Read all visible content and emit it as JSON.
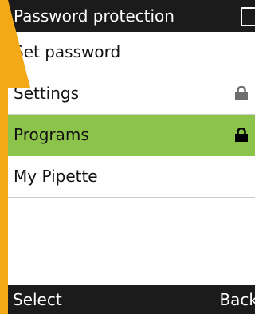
{
  "header": {
    "title": "Password protection",
    "battery_icon": "battery-icon"
  },
  "menu": {
    "items": [
      {
        "label": "Set password",
        "icon": "",
        "selected": false
      },
      {
        "label": "Settings",
        "icon": "lock-icon",
        "icon_color": "#6e6e6e",
        "selected": false
      },
      {
        "label": "Programs",
        "icon": "lock-icon",
        "icon_color": "#000000",
        "selected": true
      },
      {
        "label": "My Pipette",
        "icon": "",
        "selected": false
      }
    ]
  },
  "softkeys": {
    "left": "Select",
    "right": "Back"
  },
  "colors": {
    "accent": "#8cc34a",
    "frame": "#f3a915",
    "bar": "#1b1b1b"
  }
}
